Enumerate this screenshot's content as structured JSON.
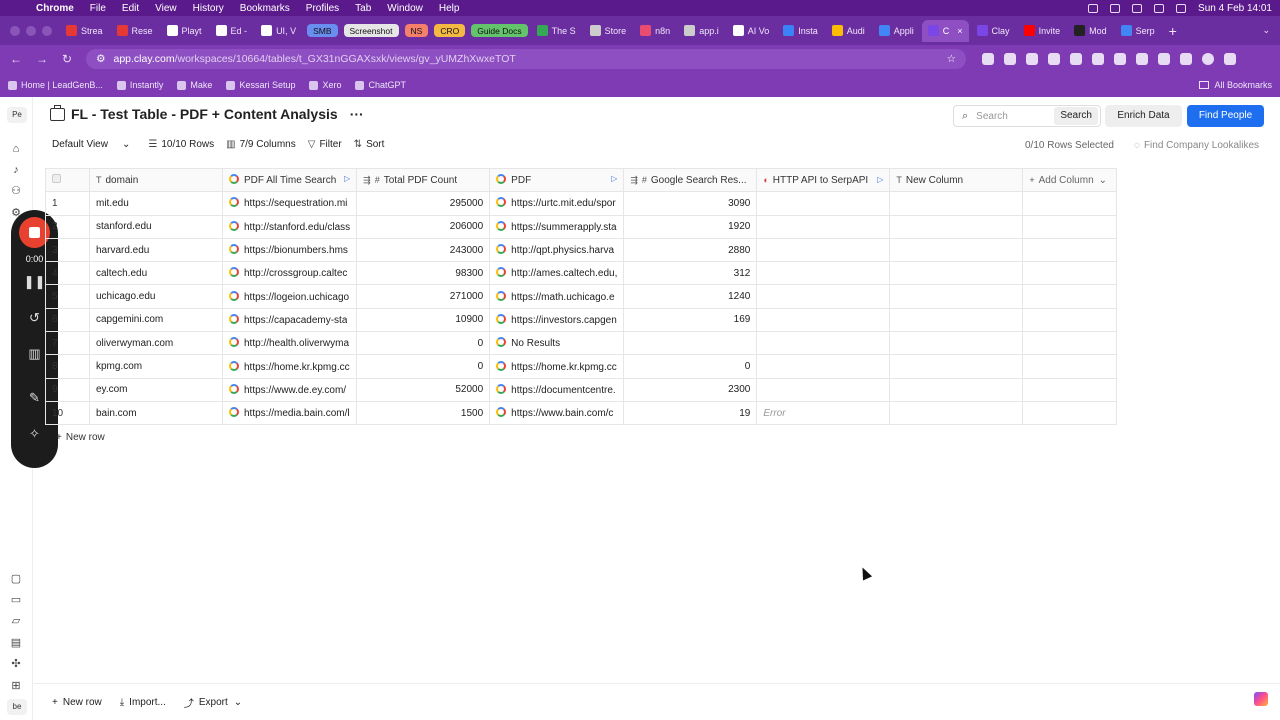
{
  "menubar": {
    "app": "Chrome",
    "items": [
      "File",
      "Edit",
      "View",
      "History",
      "Bookmarks",
      "Profiles",
      "Tab",
      "Window",
      "Help"
    ],
    "clock": "Sun 4 Feb  14:01"
  },
  "tabs": [
    {
      "label": "Strea",
      "color": "#e53935"
    },
    {
      "label": "Rese",
      "color": "#e53935"
    },
    {
      "label": "Playt",
      "color": "#ffffff"
    },
    {
      "label": "Ed -",
      "color": "#ffffff"
    },
    {
      "label": "UI, V",
      "color": "#ffffff"
    },
    {
      "label": "SMB",
      "pill": true,
      "color": "#6a8df0"
    },
    {
      "label": "Screenshot",
      "pill": true,
      "color": "#e6e6e6"
    },
    {
      "label": "NS",
      "pill": true,
      "color": "#f47f6a"
    },
    {
      "label": "CRO",
      "pill": true,
      "color": "#f4b942"
    },
    {
      "label": "Guide Docs",
      "pill": true,
      "color": "#63c46b"
    },
    {
      "label": "The S",
      "color": "#34a853"
    },
    {
      "label": "Store",
      "color": "#cccccc"
    },
    {
      "label": "n8n",
      "color": "#ea4b71"
    },
    {
      "label": "app.i",
      "color": "#cccccc"
    },
    {
      "label": "AI Vo",
      "color": "#ffffff"
    },
    {
      "label": "Insta",
      "color": "#3b82f6"
    },
    {
      "label": "Audi",
      "color": "#fbbc05"
    },
    {
      "label": "Appli",
      "color": "#4285f4"
    },
    {
      "label": "C",
      "color": "#7a46e6",
      "active": true
    },
    {
      "label": "Clay",
      "color": "#7a46e6"
    },
    {
      "label": "Invite",
      "color": "#ff0000"
    },
    {
      "label": "Mod",
      "color": "#222222"
    },
    {
      "label": "Serp",
      "color": "#4285f4"
    }
  ],
  "address": {
    "domain": "app.clay.com",
    "path": "/workspaces/10664/tables/t_GX31nGGAXsxk/views/gv_yUMZhXwxeTOT"
  },
  "bookmarks": [
    "Home | LeadGenB...",
    "Instantly",
    "Make",
    "Kessari Setup",
    "Xero",
    "ChatGPT"
  ],
  "bookmarks_all": "All Bookmarks",
  "workspace_badge": "Pe",
  "workspace_badge_bottom": "be",
  "recorder": {
    "time": "0:00"
  },
  "page": {
    "title": "FL - Test Table - PDF + Content Analysis",
    "more": "···",
    "search_placeholder": "Search",
    "search_button": "Search",
    "enrich": "Enrich Data",
    "find_people": "Find People"
  },
  "toolbar": {
    "view": "Default View",
    "rows": "10/10 Rows",
    "columns": "7/9 Columns",
    "filter": "Filter",
    "sort": "Sort",
    "rows_selected": "0/10 Rows Selected",
    "lookalikes": "Find Company Lookalikes"
  },
  "columns": [
    {
      "label": "domain",
      "icon": "T"
    },
    {
      "label": "PDF All Time Search",
      "icon": "G"
    },
    {
      "label": "Total PDF Count",
      "icon": "#"
    },
    {
      "label": "PDF",
      "icon": "G"
    },
    {
      "label": "Google Search Res...",
      "icon": "#"
    },
    {
      "label": "HTTP API to SerpAPI",
      "icon": "C"
    },
    {
      "label": "New Column",
      "icon": "T"
    },
    {
      "label": "Add Column",
      "icon": "+"
    }
  ],
  "rows": [
    {
      "n": "1",
      "domain": "mit.edu",
      "search": "https://sequestration.mi",
      "count": "295000",
      "pdf": "https://urtc.mit.edu/spor",
      "gres": "3090",
      "http": ""
    },
    {
      "n": "2",
      "domain": "stanford.edu",
      "search": "http://stanford.edu/class",
      "count": "206000",
      "pdf": "https://summerapply.sta",
      "gres": "1920",
      "http": ""
    },
    {
      "n": "3",
      "domain": "harvard.edu",
      "search": "https://bionumbers.hms",
      "count": "243000",
      "pdf": "http://qpt.physics.harva",
      "gres": "2880",
      "http": ""
    },
    {
      "n": "4",
      "domain": "caltech.edu",
      "search": "http://crossgroup.caltec",
      "count": "98300",
      "pdf": "http://ames.caltech.edu,",
      "gres": "312",
      "http": ""
    },
    {
      "n": "5",
      "domain": "uchicago.edu",
      "search": "https://logeion.uchicago",
      "count": "271000",
      "pdf": "https://math.uchicago.e",
      "gres": "1240",
      "http": ""
    },
    {
      "n": "6",
      "domain": "capgemini.com",
      "search": "https://capacademy-sta",
      "count": "10900",
      "pdf": "https://investors.capgen",
      "gres": "169",
      "http": ""
    },
    {
      "n": "7",
      "domain": "oliverwyman.com",
      "search": "http://health.oliverwyma",
      "count": "0",
      "pdf": "No Results",
      "gres": "",
      "http": ""
    },
    {
      "n": "8",
      "domain": "kpmg.com",
      "search": "https://home.kr.kpmg.cc",
      "count": "0",
      "pdf": "https://home.kr.kpmg.cc",
      "gres": "0",
      "http": ""
    },
    {
      "n": "9",
      "domain": "ey.com",
      "search": "https://www.de.ey.com/",
      "count": "52000",
      "pdf": "https://documentcentre.",
      "gres": "2300",
      "http": ""
    },
    {
      "n": "10",
      "domain": "bain.com",
      "search": "https://media.bain.com/l",
      "count": "1500",
      "pdf": "https://www.bain.com/c",
      "gres": "19",
      "http": "Error"
    }
  ],
  "new_row": "New row",
  "footer": {
    "new_row": "New row",
    "import": "Import...",
    "export": "Export"
  }
}
